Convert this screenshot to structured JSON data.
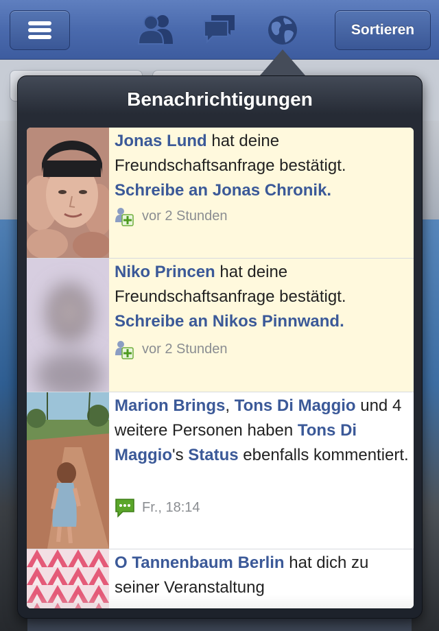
{
  "header": {
    "menu_icon": "hamburger-menu-icon",
    "friends_icon": "friend-requests-icon",
    "messages_icon": "messages-icon",
    "notifications_icon": "globe-notifications-icon",
    "sort_label": "Sortieren",
    "brand_color": "#3b5998"
  },
  "popover": {
    "title": "Benachrichtigungen"
  },
  "notifications": [
    {
      "actor": "Jonas Lund",
      "text1": " hat deine Freundschaftsanfrage bestätigt. ",
      "cta": "Schreibe an Jonas Chronik.",
      "icon": "friend-added-icon",
      "time": "vor 2 Stunden",
      "unread": true
    },
    {
      "actor": "Niko Princen",
      "text1": " hat deine Freundschaftsanfrage bestätigt. ",
      "cta": "Schreibe an Nikos Pinnwand.",
      "icon": "friend-added-icon",
      "time": "vor 2 Stunden",
      "unread": true
    },
    {
      "actor": "Marion Brings",
      "sep": ", ",
      "actor2": "Tons Di Maggio",
      "text1": " und 4 weitere Personen haben ",
      "owner": "Tons Di Maggio",
      "poss": "'s ",
      "target": "Status",
      "text2": " ebenfalls kommentiert.",
      "icon": "comment-icon",
      "time": "Fr., 18:14",
      "unread": false
    },
    {
      "actor": "O Tannenbaum Berlin",
      "text1": " hat dich zu seiner Veranstaltung",
      "unread": false
    }
  ]
}
